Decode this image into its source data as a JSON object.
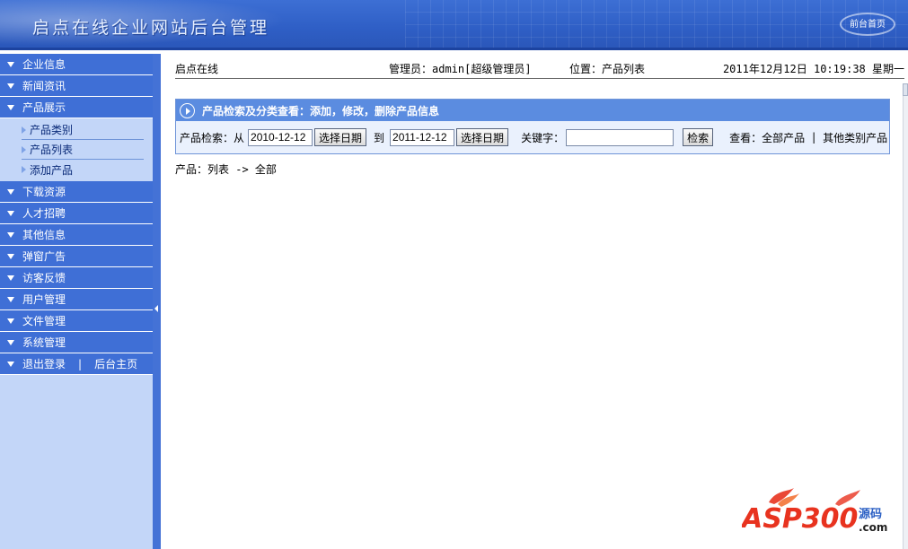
{
  "header": {
    "title": "启点在线企业网站后台管理",
    "front_link": "前台首页"
  },
  "sidebar": {
    "items": [
      {
        "label": "企业信息"
      },
      {
        "label": "新闻资讯"
      },
      {
        "label": "产品展示",
        "expanded": true,
        "children": [
          "产品类别",
          "产品列表",
          "添加产品"
        ]
      },
      {
        "label": "下载资源"
      },
      {
        "label": "人才招聘"
      },
      {
        "label": "其他信息"
      },
      {
        "label": "弹窗广告"
      },
      {
        "label": "访客反馈"
      },
      {
        "label": "用户管理"
      },
      {
        "label": "文件管理"
      },
      {
        "label": "系统管理"
      }
    ],
    "logout": "退出登录",
    "separator": "|",
    "admin_home": "后台主页"
  },
  "topbar": {
    "site": "启点在线",
    "admin": "管理员：admin[超级管理员]",
    "location": "位置：产品列表",
    "datetime": "2011年12月12日 10:19:38 星期一"
  },
  "panel": {
    "title": "产品检索及分类查看：添加，修改，删除产品信息",
    "search_label": "产品检索：从",
    "from_date": "2010-12-12",
    "choose_date_1": "选择日期",
    "to_label": "到",
    "to_date": "2011-12-12",
    "choose_date_2": "选择日期",
    "keyword_label": "关键字：",
    "search_button": "检索",
    "view_label": "查看：",
    "all_products": "全部产品",
    "view_separator": "|",
    "other_products": "其他类别产品"
  },
  "breadcrumb": "产品：列表 -> 全部",
  "watermark": {
    "brand": "ASP300",
    "suffix": "源码",
    "domain": ".com"
  },
  "colors": {
    "header_blue": "#2f5fc6",
    "menu_blue": "#3f6fd6",
    "sidebar_bg": "#c3d6f8",
    "panel_head": "#5b8ce0",
    "watermark_red": "#e8331f",
    "watermark_blue": "#2a5fc4"
  }
}
